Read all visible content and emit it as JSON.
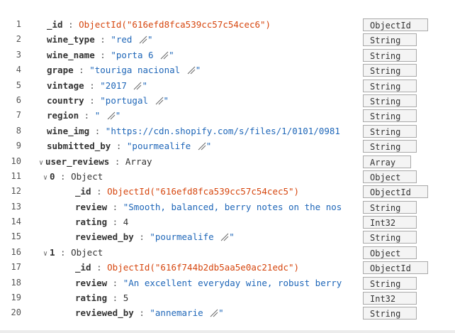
{
  "rows": [
    {
      "line": "1",
      "key": "_id",
      "kind": "oid",
      "value": "ObjectId(\"616efd8fca539cc57c54cec6\")",
      "type": "ObjectId"
    },
    {
      "line": "2",
      "key": "wine_type",
      "kind": "str",
      "value": "red ",
      "type": "String"
    },
    {
      "line": "3",
      "key": "wine_name",
      "kind": "str",
      "value": "porta 6 ",
      "type": "String"
    },
    {
      "line": "4",
      "key": "grape",
      "kind": "str",
      "value": "touriga nacional ",
      "type": "String"
    },
    {
      "line": "5",
      "key": "vintage",
      "kind": "str",
      "value": "2017 ",
      "type": "String"
    },
    {
      "line": "6",
      "key": "country",
      "kind": "str",
      "value": "portugal ",
      "type": "String"
    },
    {
      "line": "7",
      "key": "region",
      "kind": "str",
      "value": "    ",
      "type": "String"
    },
    {
      "line": "8",
      "key": "wine_img",
      "kind": "strlong",
      "value": "https://cdn.shopify.com/s/files/1/0101/0981",
      "type": "String"
    },
    {
      "line": "9",
      "key": "submitted_by",
      "kind": "str",
      "value": "pourmealife ",
      "type": "String"
    },
    {
      "line": "10",
      "key": "user_reviews",
      "kind": "array",
      "value": "Array",
      "type": "Array"
    },
    {
      "line": "11",
      "key": "0",
      "kind": "object",
      "value": "Object",
      "type": "Object"
    },
    {
      "line": "12",
      "key": "_id",
      "kind": "oid",
      "value": "ObjectId(\"616efd8fca539cc57c54cec5\")",
      "type": "ObjectId"
    },
    {
      "line": "13",
      "key": "review",
      "kind": "strlong",
      "value": "Smooth, balanced, berry notes on the nos",
      "type": "String"
    },
    {
      "line": "14",
      "key": "rating",
      "kind": "num",
      "value": "4",
      "type": "Int32"
    },
    {
      "line": "15",
      "key": "reviewed_by",
      "kind": "str",
      "value": "pourmealife ",
      "type": "String"
    },
    {
      "line": "16",
      "key": "1",
      "kind": "object",
      "value": "Object",
      "type": "Object"
    },
    {
      "line": "17",
      "key": "_id",
      "kind": "oid",
      "value": "ObjectId(\"616f744b2db5aa5e0ac21edc\")",
      "type": "ObjectId"
    },
    {
      "line": "18",
      "key": "review",
      "kind": "strlong",
      "value": "An excellent everyday wine, robust berry",
      "type": "String"
    },
    {
      "line": "19",
      "key": "rating",
      "kind": "num",
      "value": "5",
      "type": "Int32"
    },
    {
      "line": "20",
      "key": "reviewed_by",
      "kind": "str",
      "value": "annemarie ",
      "type": "String"
    }
  ],
  "colors": {
    "objectid": "#d6460e",
    "string": "#1e66b8",
    "key": "#333333",
    "typebox_border": "#a9a9a9"
  },
  "icons": {
    "expanded": "chevron-down-icon",
    "resize": "resize-handle-icon"
  }
}
